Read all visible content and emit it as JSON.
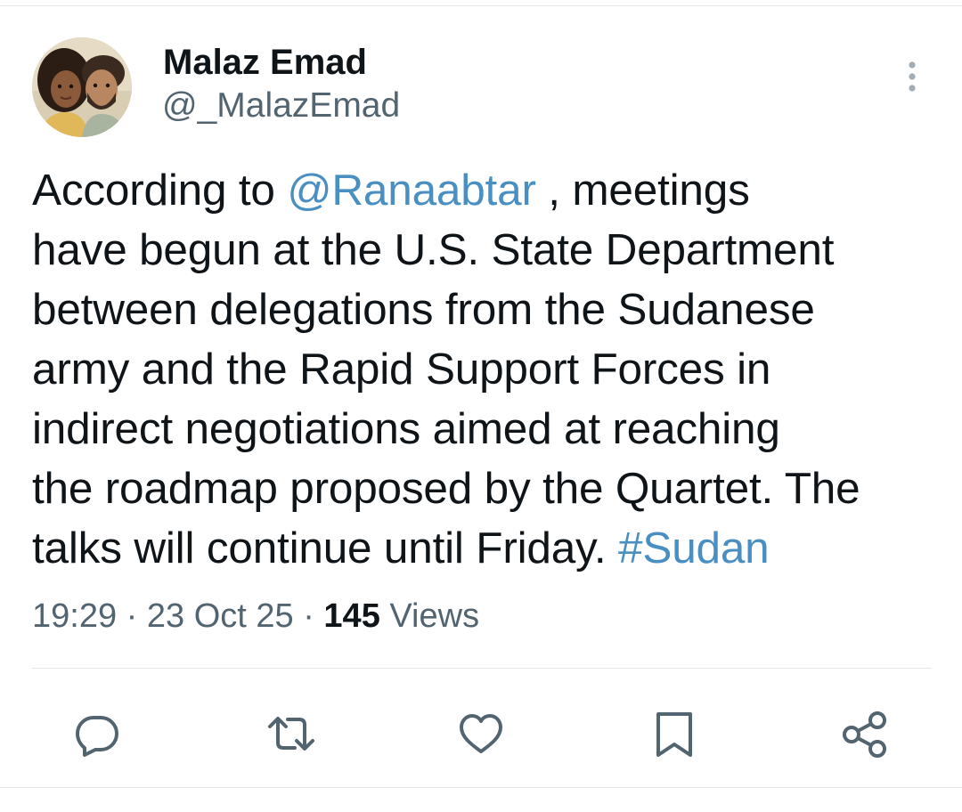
{
  "author": {
    "display_name": "Malaz Emad",
    "handle": "@_MalazEmad"
  },
  "tweet": {
    "lines": [
      [
        {
          "text": "According to "
        },
        {
          "text": "@Ranaabtar",
          "link": true
        },
        {
          "text": " , meetings"
        }
      ],
      [
        {
          "text": "have begun at the U.S. State Department"
        }
      ],
      [
        {
          "text": "between delegations from the Sudanese"
        }
      ],
      [
        {
          "text": "army and the Rapid Support Forces in"
        }
      ],
      [
        {
          "text": "indirect negotiations aimed at reaching"
        }
      ],
      [
        {
          "text": "the roadmap proposed by the Quartet. The"
        }
      ],
      [
        {
          "text": "talks will continue until Friday. "
        },
        {
          "text": "#Sudan",
          "link": true
        }
      ]
    ]
  },
  "meta": {
    "time": "19:29",
    "separator": " · ",
    "date": "23 Oct 25",
    "views_count": "145",
    "views_label": " Views"
  },
  "actions": {
    "reply_icon": "reply-icon",
    "repost_icon": "repost-icon",
    "like_icon": "heart-icon",
    "bookmark_icon": "bookmark-icon",
    "share_icon": "share-icon"
  },
  "colors": {
    "text": "#0f1419",
    "secondary": "#536471",
    "link": "#4a8fc2",
    "divider": "#e3e6e9"
  }
}
